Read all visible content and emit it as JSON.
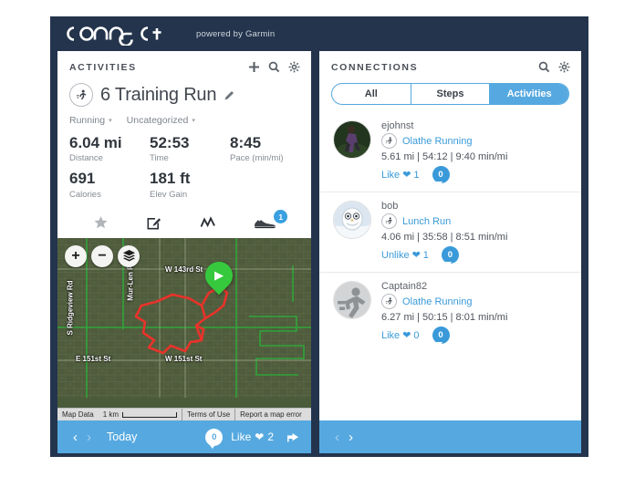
{
  "brand": {
    "name": "connect",
    "tagline": "powered by Garmin"
  },
  "colors": {
    "navy": "#23344c",
    "accent_blue": "#56a9e0",
    "link_blue": "#3a9ad9",
    "pin_green": "#36c93d",
    "track_red": "#e8332a"
  },
  "activities_panel": {
    "title": "ACTIVITIES",
    "icons": [
      "plus-icon",
      "search-icon",
      "gear-icon"
    ],
    "activity": {
      "type_icon": "running-icon",
      "name": "6 Training Run",
      "edit_icon": "pencil-icon",
      "tags": [
        {
          "label": "Running",
          "caret": "▾"
        },
        {
          "label": "Uncategorized",
          "caret": "▾"
        }
      ],
      "stats": [
        [
          {
            "value": "6.04 mi",
            "label": "Distance"
          },
          {
            "value": "52:53",
            "label": "Time"
          },
          {
            "value": "8:45",
            "label": "Pace (min/mi)"
          }
        ],
        [
          {
            "value": "691",
            "label": "Calories"
          },
          {
            "value": "181 ft",
            "label": "Elev Gain"
          }
        ]
      ],
      "tool_icons": [
        {
          "name": "star-icon",
          "badge": null
        },
        {
          "name": "edit-note-icon",
          "badge": null
        },
        {
          "name": "chart-line-icon",
          "badge": null
        },
        {
          "name": "shoe-icon",
          "badge": "1"
        }
      ]
    },
    "map": {
      "controls": [
        {
          "name": "zoom-in-button",
          "glyph": "+"
        },
        {
          "name": "zoom-out-button",
          "glyph": "−"
        },
        {
          "name": "layers-button",
          "glyph": "layers-icon"
        }
      ],
      "road_labels": [
        "W 143rd St",
        "W 151st St",
        "E 151st St",
        "S Ridgeview Rd",
        "Mur-Len Rd"
      ],
      "attribution": {
        "map_data": "Map Data",
        "scale": "1 km",
        "terms": "Terms of Use",
        "report": "Report a map error"
      }
    },
    "footer": {
      "prev_icon": "chevron-left-icon",
      "next_icon": "chevron-right-icon",
      "date_label": "Today",
      "comment_count": "0",
      "like_label": "Like",
      "like_count": "2",
      "share_icon": "share-icon"
    }
  },
  "connections_panel": {
    "title": "CONNECTIONS",
    "icons": [
      "search-icon",
      "gear-icon"
    ],
    "tabs": [
      {
        "label": "All",
        "selected": false
      },
      {
        "label": "Steps",
        "selected": false
      },
      {
        "label": "Activities",
        "selected": true
      }
    ],
    "entries": [
      {
        "user": "ejohnst",
        "avatar": "photo-runner-avatar",
        "activity_icon": "running-icon",
        "activity_name": "Olathe Running",
        "stats": "5.61 mi | 54:12 | 9:40 min/mi",
        "like_label": "Like",
        "like_count": "1",
        "comment_count": "0"
      },
      {
        "user": "bob",
        "avatar": "owl-avatar",
        "activity_icon": "running-icon",
        "activity_name": "Lunch Run",
        "stats": "4.06 mi | 35:58 | 8:51 min/mi",
        "like_label": "Unlike",
        "like_count": "1",
        "comment_count": "0"
      },
      {
        "user": "Captain82",
        "avatar": "default-runner-avatar",
        "activity_icon": "running-icon",
        "activity_name": "Olathe Running",
        "stats": "6.27 mi | 50:15 | 8:01 min/mi",
        "like_label": "Like",
        "like_count": "0",
        "comment_count": "0"
      }
    ],
    "footer": {
      "prev_icon": "chevron-left-icon",
      "next_icon": "chevron-right-icon"
    }
  }
}
